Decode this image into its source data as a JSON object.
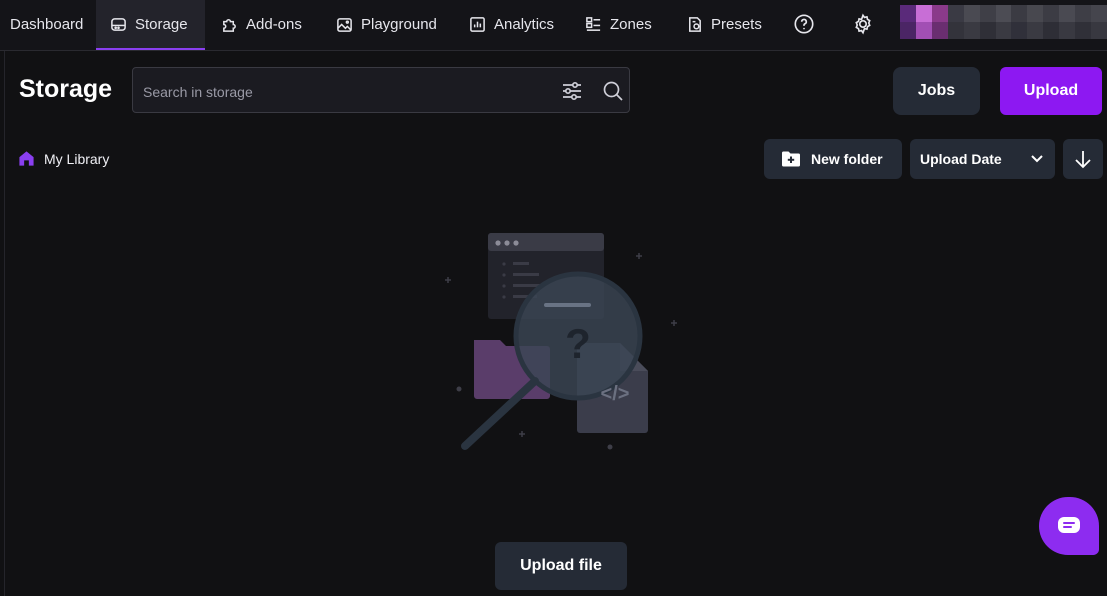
{
  "nav": {
    "items": [
      {
        "label": "Dashboard",
        "icon": "none"
      },
      {
        "label": "Storage",
        "icon": "storage-icon",
        "active": true
      },
      {
        "label": "Add-ons",
        "icon": "puzzle-icon"
      },
      {
        "label": "Playground",
        "icon": "image-spark-icon"
      },
      {
        "label": "Analytics",
        "icon": "chart-icon"
      },
      {
        "label": "Zones",
        "icon": "zones-icon"
      },
      {
        "label": "Presets",
        "icon": "preset-icon"
      }
    ],
    "help_icon": "help-circle-icon",
    "settings_icon": "gear-icon"
  },
  "page": {
    "title": "Storage"
  },
  "search": {
    "placeholder": "Search in storage",
    "value": ""
  },
  "actions": {
    "jobs_label": "Jobs",
    "upload_label": "Upload",
    "new_folder_label": "New folder",
    "sort_value": "Upload Date",
    "upload_file_label": "Upload file"
  },
  "breadcrumb": {
    "root_label": "My Library"
  },
  "colors": {
    "accent": "#8d18f2",
    "background": "#111113",
    "button_bg": "#252b36"
  }
}
